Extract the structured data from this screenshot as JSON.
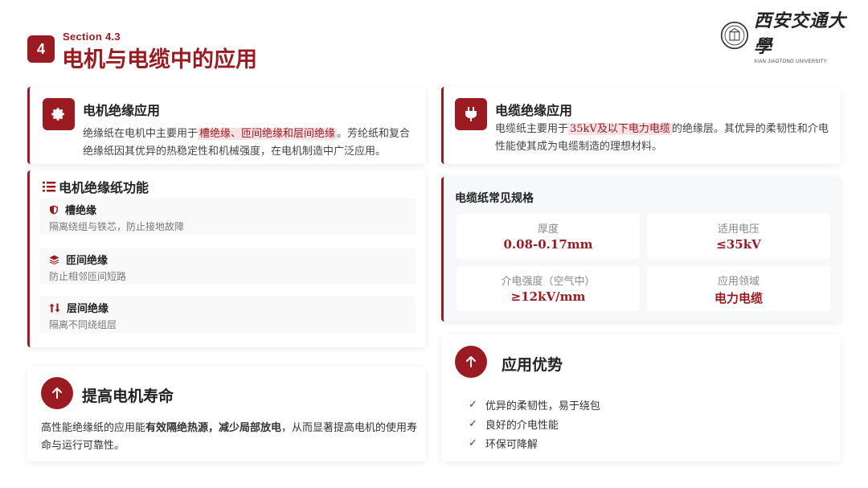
{
  "header": {
    "section_number": "4",
    "section_label": "Section 4.3",
    "title": "电机与电缆中的应用",
    "logo_cn": "西安交通大學",
    "logo_en": "XIAN JIAOTONG UNIVERSITY"
  },
  "motor_insulation": {
    "title": "电机绝缘应用",
    "text_before": "绝缘纸在电机中主要用于",
    "highlight": "槽绝缘、匝间绝缘和层间绝缘",
    "text_after": "。芳纶纸和复合绝缘纸因其优异的热稳定性和机械强度，在电机制造中广泛应用。",
    "icon": "gear-icon"
  },
  "motor_functions": {
    "title": "电机绝缘纸功能",
    "items": [
      {
        "title": "槽绝缘",
        "desc": "隔离绕组与铁芯，防止接地故障",
        "icon": "shield-icon"
      },
      {
        "title": "匝间绝缘",
        "desc": "防止相邻匝间短路",
        "icon": "layers-icon"
      },
      {
        "title": "层间绝缘",
        "desc": "隔离不同绕组层",
        "icon": "swap-vertical-icon"
      }
    ]
  },
  "life": {
    "title": "提高电机寿命",
    "text_before": "高性能绝缘纸的应用能",
    "bold": "有效隔绝热源，减少局部放电",
    "text_after": "，从而显著提高电机的使用寿命与运行可靠性。"
  },
  "cable_insulation": {
    "title": "电缆绝缘应用",
    "text_before": "电缆纸主要用于",
    "highlight": "35kV及以下电力电缆",
    "text_after": "的绝缘层。其优异的柔韧性和介电性能使其成为电缆制造的理想材料。",
    "icon": "plug-icon"
  },
  "cable_specs": {
    "title": "电缆纸常见规格",
    "cells": [
      {
        "label": "厚度",
        "value": "0.08-0.17mm"
      },
      {
        "label": "适用电压",
        "value": "≤35kV"
      },
      {
        "label": "介电强度（空气中）",
        "value": "≥12kV/mm"
      },
      {
        "label": "应用领域",
        "value": "电力电缆"
      }
    ]
  },
  "advantages": {
    "title": "应用优势",
    "items": [
      "优异的柔韧性，易于绕包",
      "良好的介电性能",
      "环保可降解"
    ]
  },
  "colors": {
    "accent": "#9b1b22",
    "highlight_bg": "#f8e1e2"
  }
}
